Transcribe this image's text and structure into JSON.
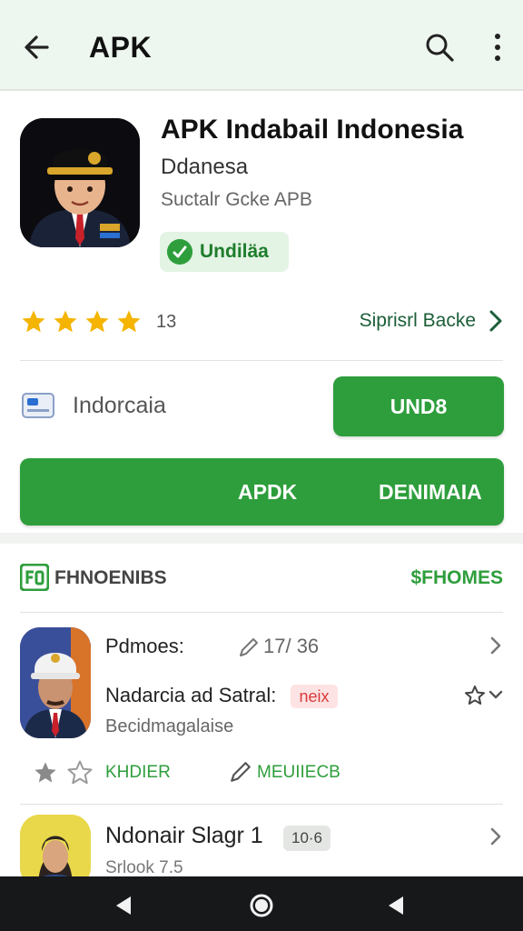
{
  "header": {
    "title": "APK"
  },
  "app": {
    "name": "APK Indabail Indonesia",
    "developer": "Ddanesa",
    "subtitle": "Suctalr Gcke APB",
    "verified_label": "Undiläa"
  },
  "rating": {
    "stars": 4,
    "count": "13",
    "support_link": "Siprisrl Backe"
  },
  "language": {
    "label": "Indorcaia",
    "button_small": "UND8"
  },
  "big_button": {
    "label_left": "APDK",
    "label_right": "DENIMAIA"
  },
  "section": {
    "title": "FHNOENIBS",
    "link": "$FHOMES"
  },
  "items": [
    {
      "title": "Pdmoes:",
      "meta": "17/ 36",
      "line2": "Nadarcia ad Satral:",
      "badge": "neix",
      "line3": "Becidmagalaise",
      "action1": "KHDIER",
      "action2": "MEUIIECB"
    },
    {
      "title": "Ndonair Slagr 1",
      "badge": "10·6",
      "line2": "Srlook 7.5"
    }
  ],
  "colors": {
    "accent": "#2e9e3c",
    "header_bg": "#eef7ef",
    "badge_red": "#d93b3b"
  }
}
